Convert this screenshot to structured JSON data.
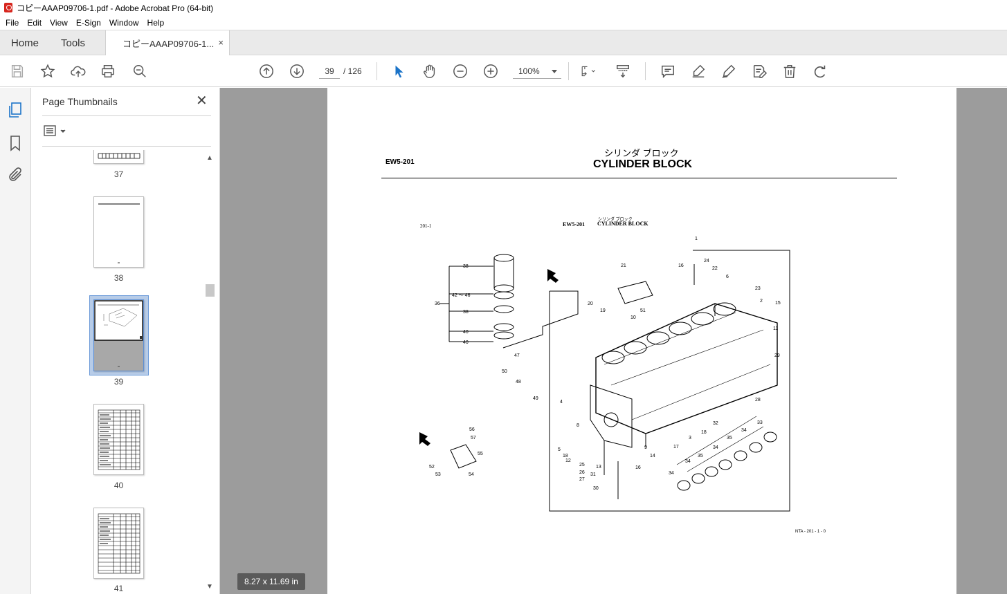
{
  "window": {
    "title": "コピーAAAP09706-1.pdf - Adobe Acrobat Pro (64-bit)"
  },
  "menu": [
    "File",
    "Edit",
    "View",
    "E-Sign",
    "Window",
    "Help"
  ],
  "tabs": {
    "home": "Home",
    "tools": "Tools",
    "document": "コピーAAAP09706-1...",
    "close": "×"
  },
  "toolbar": {
    "page_current": "39",
    "page_of": "/  126",
    "zoom": "100%",
    "icons": [
      "save-icon",
      "star-icon",
      "upload-icon",
      "print-icon",
      "zoom-out-search-icon",
      "page-up-icon",
      "page-down-icon",
      "select-arrow-icon",
      "hand-icon",
      "zoom-out-icon",
      "zoom-in-icon",
      "fit-page-icon",
      "scroll-mode-icon",
      "comment-icon",
      "highlight-icon",
      "sign-icon",
      "edit-pdf-icon",
      "delete-icon",
      "rotate-icon"
    ]
  },
  "thumbnails_panel": {
    "title": "Page Thumbnails",
    "close": "✕",
    "pages": [
      {
        "label": "37"
      },
      {
        "label": "38"
      },
      {
        "label": "39",
        "selected": true
      },
      {
        "label": "40"
      },
      {
        "label": "41"
      }
    ]
  },
  "document": {
    "header_jp": "シリンダ ブロック",
    "header_en": "CYLINDER BLOCK",
    "doc_code": "EW5-201",
    "figure_ref": "201-1",
    "figure_code": "EW5-201",
    "figure_jp": "シリンダ ブロック",
    "figure_en": "CYLINDER BLOCK",
    "footer_code": "NTA - 201 - 1 - 0",
    "callouts": [
      "1",
      "2",
      "3",
      "4",
      "5",
      "6",
      "8",
      "9",
      "10",
      "11",
      "12",
      "13",
      "14",
      "15",
      "16",
      "17",
      "18",
      "19",
      "20",
      "21",
      "22",
      "23",
      "24",
      "25",
      "26",
      "27",
      "28",
      "29",
      "30",
      "31",
      "32",
      "33",
      "34",
      "35",
      "36",
      "38",
      "40",
      "42 ～ 46",
      "47",
      "48",
      "49",
      "50",
      "51",
      "52",
      "53",
      "54",
      "55",
      "56",
      "57"
    ]
  },
  "status": {
    "page_size": "8.27 x 11.69 in"
  },
  "colors": {
    "accent": "#1a73c8",
    "doc_bg": "#9c9c9c",
    "selected_thumb": "#b7cce8"
  }
}
